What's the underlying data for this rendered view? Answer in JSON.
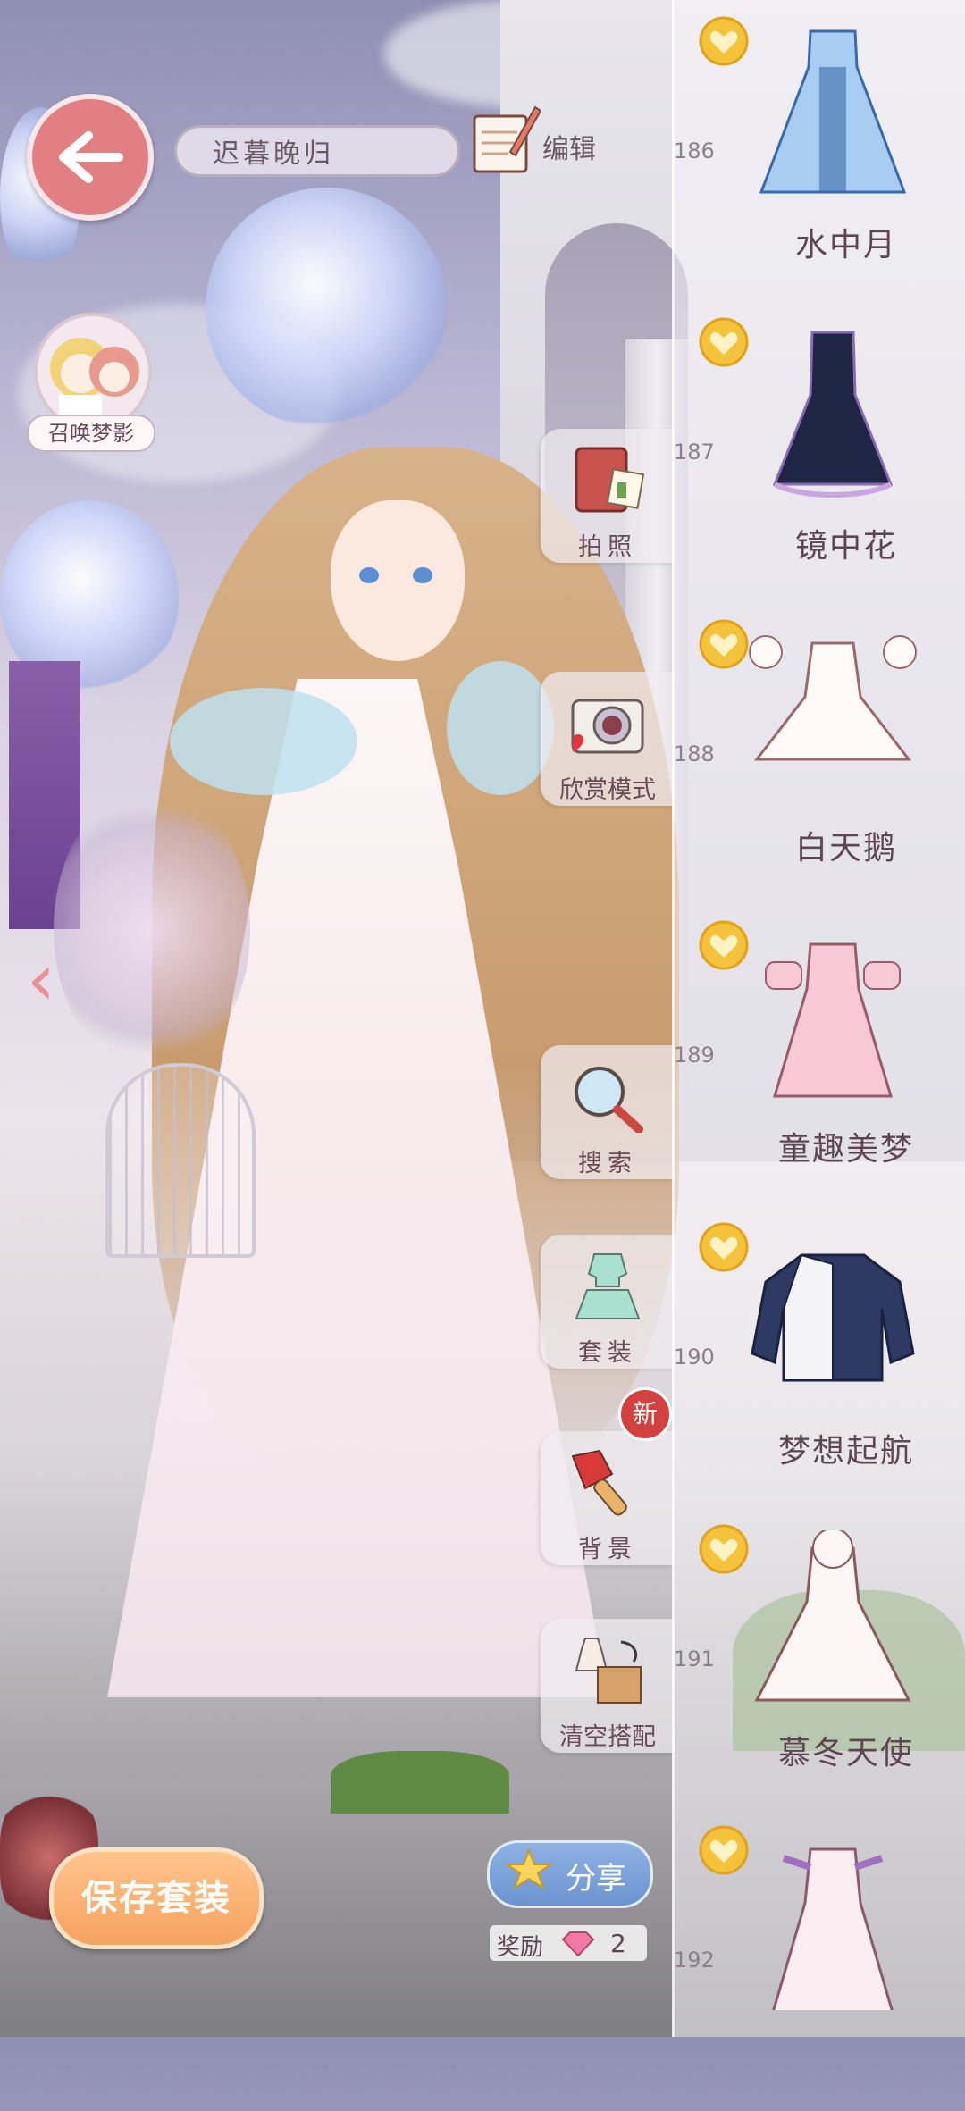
{
  "header": {
    "back_icon": "arrow-left-icon",
    "outfit_name": "迟暮晚归",
    "edit_label": "编辑",
    "summon_label": "召唤梦影"
  },
  "tools": [
    {
      "label": "拍照",
      "icon": "photo-album-icon"
    },
    {
      "label": "欣赏模式",
      "icon": "camera-icon"
    },
    {
      "label": "搜索",
      "icon": "magnifier-icon"
    },
    {
      "label": "套装",
      "icon": "outfit-set-icon"
    },
    {
      "label": "背景",
      "icon": "paint-brush-icon",
      "badge": "新"
    },
    {
      "label": "清空搭配",
      "icon": "clear-outfit-icon"
    }
  ],
  "list": [
    {
      "number": "186",
      "name": "水中月"
    },
    {
      "number": "187",
      "name": "镜中花"
    },
    {
      "number": "188",
      "name": "白天鹅"
    },
    {
      "number": "189",
      "name": "童趣美梦"
    },
    {
      "number": "190",
      "name": "梦想起航"
    },
    {
      "number": "191",
      "name": "慕冬天使"
    },
    {
      "number": "192",
      "name": ""
    }
  ],
  "bottom": {
    "save_label": "保存套装",
    "share_label": "分享",
    "reward_label": "奖励",
    "reward_count": "2"
  },
  "colors": {
    "accent": "#e27f85",
    "save_button": "#f6a25f",
    "share_button": "#6c93d0",
    "badge": "#d2403f"
  }
}
